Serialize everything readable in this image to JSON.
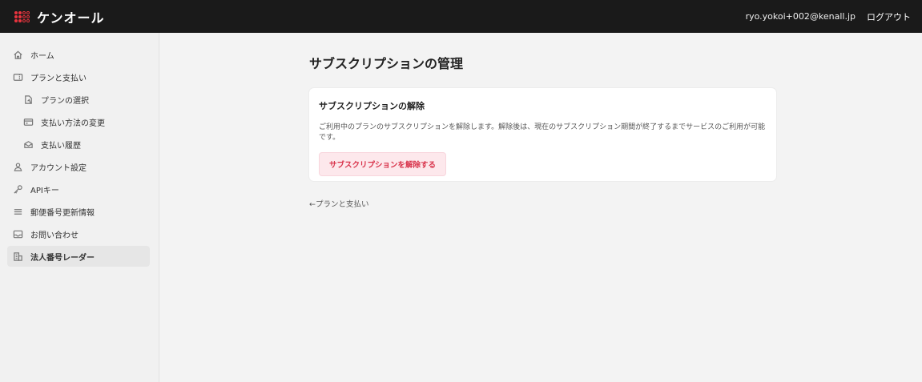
{
  "header": {
    "brand": "ケンオール",
    "user_email": "ryo.yokoi+002@kenall.jp",
    "logout_label": "ログアウト"
  },
  "sidebar": {
    "items": [
      {
        "label": "ホーム",
        "icon": "home-icon"
      },
      {
        "label": "プランと支払い",
        "icon": "ticket-icon"
      },
      {
        "label": "プランの選択",
        "icon": "document-icon"
      },
      {
        "label": "支払い方法の変更",
        "icon": "credit-card-icon"
      },
      {
        "label": "支払い履歴",
        "icon": "receipt-icon"
      },
      {
        "label": "アカウント設定",
        "icon": "user-icon"
      },
      {
        "label": "APIキー",
        "icon": "key-icon"
      },
      {
        "label": "郵便番号更新情報",
        "icon": "list-icon"
      },
      {
        "label": "お問い合わせ",
        "icon": "mail-icon"
      },
      {
        "label": "法人番号レーダー",
        "icon": "building-icon"
      }
    ]
  },
  "main": {
    "title": "サブスクリプションの管理",
    "card": {
      "title": "サブスクリプションの解除",
      "description": "ご利用中のプランのサブスクリプションを解除します。解除後は、現在のサブスクリプション期間が終了するまでサービスのご利用が可能です。",
      "button_label": "サブスクリプションを解除する"
    },
    "back_link": "←プランと支払い"
  },
  "colors": {
    "header_bg": "#1a1a1a",
    "brand_accent": "#e8343e",
    "danger_text": "#d8324a",
    "danger_bg": "#fde8ec"
  }
}
